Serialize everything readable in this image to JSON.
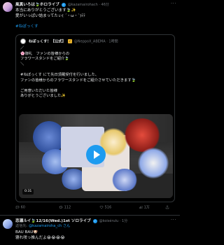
{
  "post1": {
    "author_name": "風真いろは🍃ホロライブ",
    "author_handle": "@kazamairohach · 46分",
    "more_label": "···",
    "text_lines": [
      "本当にありがとうございます🍃✨",
      "愛がいっぱい詰まってたぃ( ´・ω・`)ﾃﾃ"
    ],
    "hashtag": "#ねぽっくす",
    "quote": {
      "name": "ねぽっくす！【公式】",
      "handle": "@NeppoX_ABEMA · 1時間",
      "lines": [
        "／",
        "🌸御礼　ファンの皆様からの",
        "フラワースタンドをご紹介🍃",
        "＼",
        "",
        "#ねぽっくす にて先日頂戴受付を行いました、",
        "ファンの皆様からのフラワースタンドをご紹介させていただきます🍃",
        "",
        "ご用意いただいた皆様",
        "ありがとうございました✨"
      ],
      "video_time": "0:31"
    },
    "actions": {
      "replies": "60",
      "retweets": "112",
      "likes": "516",
      "views": "1万"
    }
  },
  "post2": {
    "author_name": "恋瀬ルイ🍃12/16(Wed.)1st ソロライブ",
    "author_handle": "@koisérulu · 1分",
    "more_label": "···",
    "reply_prefix": "返信先:",
    "reply_to": "@kazamairoha_ch さん",
    "lines": [
      "BAU BAU🐶",
      "寝れ咲っ推んだよ😭😭😭😭"
    ]
  }
}
